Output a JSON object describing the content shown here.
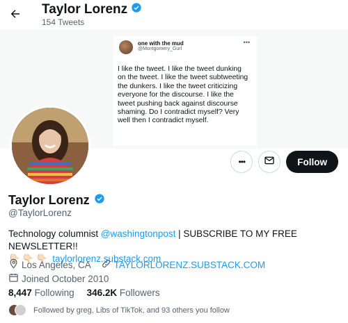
{
  "header": {
    "name": "Taylor Lorenz",
    "tweet_count": "154 Tweets"
  },
  "banner_tweet": {
    "author": "one with the mud",
    "handle": "@Montgomery_Gurl",
    "text": "I like the tweet. I like the tweet dunking on the tweet. I like the tweet subtweeting the dunkers. I like the tweet criticizing everyone for the discourse. I like the tweet pushing back against discourse shaming. Do I contradict myself? Very well then I contradict myself."
  },
  "profile": {
    "name": "Taylor Lorenz",
    "handle": "@TaylorLorenz",
    "bio_prefix": "Technology columnist ",
    "bio_mention": "@washingtonpost",
    "bio_suffix": " | SUBSCRIBE TO MY FREE NEWSLETTER!!",
    "bio_emoji": "👇🏻👇🏻👇🏻",
    "bio_link": "taylorlorenz.substack.com",
    "location": "Los Angeles, CA",
    "website": "TAYLORLORENZ.SUBSTACK.COM",
    "joined": "Joined October 2010"
  },
  "actions": {
    "follow_label": "Follow"
  },
  "stats": {
    "following_count": "8,447",
    "following_label": "Following",
    "followers_count": "346.2K",
    "followers_label": "Followers"
  },
  "followed_by": "Followed by greg, Libs of TikTok, and 93 others you follow",
  "colors": {
    "accent": "#1d9bf0",
    "text": "#0f1419",
    "secondary": "#536471",
    "follow_bg": "#0f1419"
  }
}
